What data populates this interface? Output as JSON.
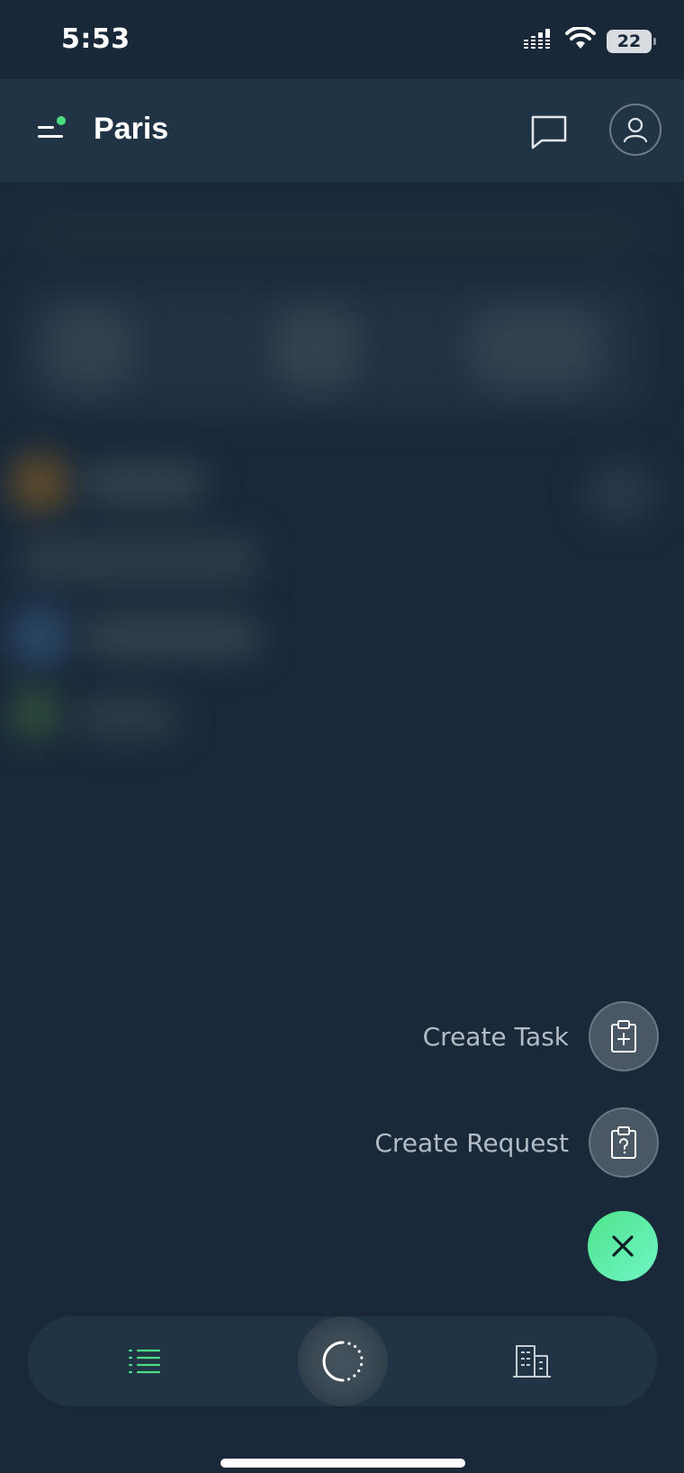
{
  "status_bar": {
    "time": "5:53",
    "battery": "22",
    "icons": [
      "cellular-signal-icon",
      "wifi-icon",
      "battery-icon"
    ]
  },
  "header": {
    "title": "Paris",
    "menu_icon": "menu-icon",
    "chat_icon": "chat-bubble-icon",
    "profile_icon": "user-icon",
    "menu_dot_color": "#4ade80"
  },
  "fab_menu": {
    "actions": [
      {
        "label": "Create Task",
        "icon": "clipboard-plus-icon"
      },
      {
        "label": "Create Request",
        "icon": "clipboard-question-icon"
      }
    ],
    "close_icon": "close-icon",
    "close_color": "#5eeaa0"
  },
  "bottom_nav": {
    "items": [
      {
        "name": "list",
        "icon": "list-icon",
        "active": true
      },
      {
        "name": "activity",
        "icon": "loading-circle-icon",
        "active": false
      },
      {
        "name": "buildings",
        "icon": "building-icon",
        "active": false
      }
    ],
    "active_color": "#4ade80"
  }
}
